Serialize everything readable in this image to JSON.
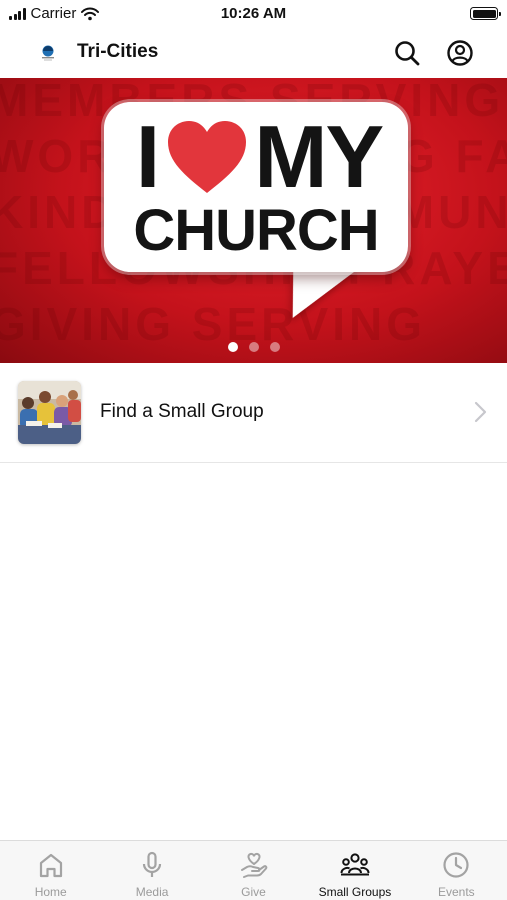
{
  "status_bar": {
    "carrier": "Carrier",
    "time": "10:26 AM"
  },
  "header": {
    "title": "Tri-Cities",
    "logo_icon": "church-logo-icon",
    "actions": [
      "search-icon",
      "account-icon"
    ]
  },
  "hero": {
    "line1_left": "I",
    "line1_right": "MY",
    "line2": "CHURCH",
    "heart_color": "#e2363c",
    "background_color": "#d0141e",
    "page_count": 3,
    "active_page": 1
  },
  "list": [
    {
      "label": "Find a Small Group",
      "icon": "small-group-photo"
    }
  ],
  "tabs": [
    {
      "label": "Home",
      "icon": "home-icon",
      "active": false
    },
    {
      "label": "Media",
      "icon": "microphone-icon",
      "active": false
    },
    {
      "label": "Give",
      "icon": "give-icon",
      "active": false
    },
    {
      "label": "Small Groups",
      "icon": "people-group-icon",
      "active": true
    },
    {
      "label": "Events",
      "icon": "clock-icon",
      "active": false
    }
  ]
}
